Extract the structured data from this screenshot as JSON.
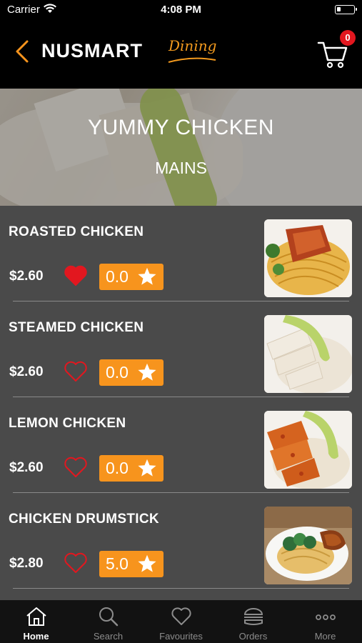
{
  "status_bar": {
    "carrier": "Carrier",
    "time": "4:08 PM"
  },
  "header": {
    "logo_main": "NUSMART",
    "logo_sub": "Dining",
    "cart_count": "0"
  },
  "hero": {
    "title": "YUMMY CHICKEN",
    "subtitle": "MAINS"
  },
  "items": [
    {
      "name": "ROASTED CHICKEN",
      "price": "$2.60",
      "favourited": true,
      "rating": "0.0"
    },
    {
      "name": "STEAMED CHICKEN",
      "price": "$2.60",
      "favourited": false,
      "rating": "0.0"
    },
    {
      "name": "LEMON CHICKEN",
      "price": "$2.60",
      "favourited": false,
      "rating": "0.0"
    },
    {
      "name": "CHICKEN DRUMSTICK",
      "price": "$2.80",
      "favourited": false,
      "rating": "5.0"
    }
  ],
  "tabs": [
    {
      "label": "Home",
      "icon": "home-icon",
      "active": true
    },
    {
      "label": "Search",
      "icon": "search-icon",
      "active": false
    },
    {
      "label": "Favourites",
      "icon": "heart-icon",
      "active": false
    },
    {
      "label": "Orders",
      "icon": "burger-icon",
      "active": false
    },
    {
      "label": "More",
      "icon": "more-icon",
      "active": false
    }
  ],
  "colors": {
    "accent": "#f7941d",
    "favourite": "#e2171f",
    "background": "#4a4a4a"
  }
}
